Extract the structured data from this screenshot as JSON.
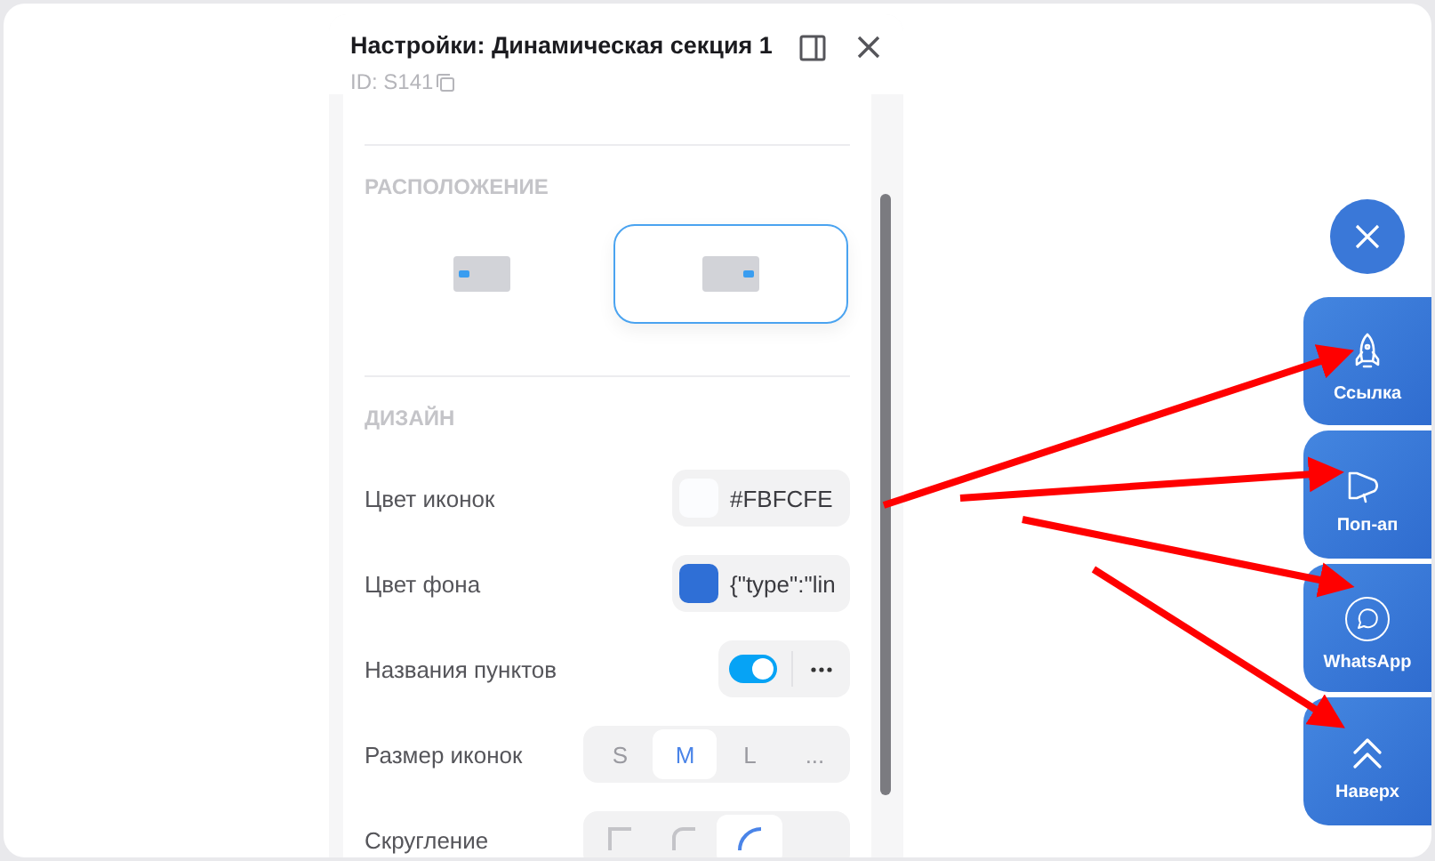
{
  "panel": {
    "title": "Настройки: Динамическая секция 1",
    "id_label": "ID: S141"
  },
  "position": {
    "title": "РАСПОЛОЖЕНИЕ",
    "options": [
      {
        "selected": false
      },
      {
        "selected": true
      }
    ]
  },
  "design": {
    "title": "ДИЗАЙН",
    "rows": [
      {
        "kind": "color",
        "label": "Цвет иконок",
        "color": "#fbfcfe",
        "value": "#FBFCFE"
      },
      {
        "kind": "color",
        "label": "Цвет фона",
        "color": "#2f6fd6",
        "value": "{\"type\":\"lin"
      },
      {
        "kind": "toggle",
        "label": "Названия пунктов",
        "on": true
      },
      {
        "kind": "segments",
        "label": "Размер иконок",
        "options": [
          {
            "label": "S",
            "selected": false
          },
          {
            "label": "M",
            "selected": true
          },
          {
            "label": "L",
            "selected": false
          },
          {
            "label": "...",
            "selected": false
          }
        ]
      },
      {
        "kind": "rounding",
        "label": "Скругление",
        "options": [
          {
            "selected": false
          },
          {
            "selected": false
          },
          {
            "selected": true
          }
        ]
      }
    ]
  },
  "widget": {
    "items": [
      {
        "label": "Ссылка"
      },
      {
        "label": "Поп-ап"
      },
      {
        "label": "WhatsApp"
      },
      {
        "label": "Наверх"
      }
    ]
  }
}
